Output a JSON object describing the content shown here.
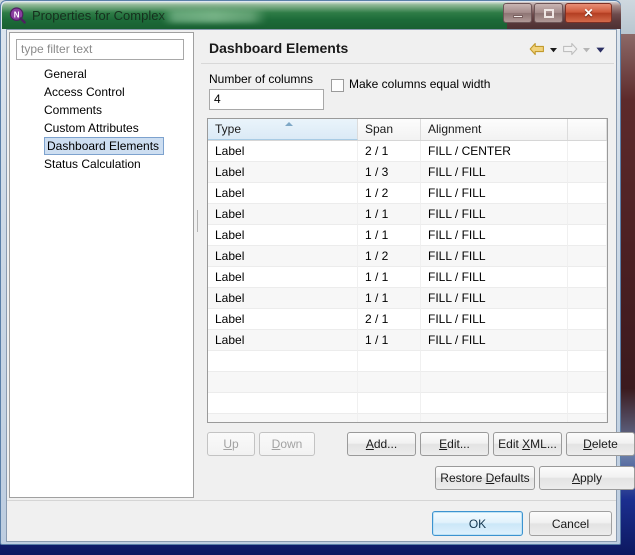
{
  "window": {
    "title": "Properties for Complex",
    "app_icon": "magnifier-n-icon",
    "controls": {
      "minimize": "minimize-icon",
      "maximize": "maximize-icon",
      "close": "✕"
    }
  },
  "sidebar": {
    "filter_placeholder": "type filter text",
    "filter_value": "",
    "items": [
      {
        "label": "General",
        "selected": false
      },
      {
        "label": "Access Control",
        "selected": false
      },
      {
        "label": "Comments",
        "selected": false
      },
      {
        "label": "Custom Attributes",
        "selected": false
      },
      {
        "label": "Dashboard Elements",
        "selected": true
      },
      {
        "label": "Status Calculation",
        "selected": false
      }
    ]
  },
  "main": {
    "title": "Dashboard Elements",
    "nav": {
      "back": "back-arrow-icon",
      "back_menu": "chevron-down-icon",
      "forward": "forward-arrow-icon",
      "forward_menu": "chevron-down-icon",
      "more_menu": "chevron-down-icon"
    },
    "columns_field": {
      "label": "Number of columns",
      "value": "4"
    },
    "equal_width": {
      "label": "Make columns equal width",
      "checked": false
    },
    "table": {
      "headers": [
        "Type",
        "Span",
        "Alignment",
        ""
      ],
      "sorted_column": "Type",
      "sort_direction": "ascending",
      "rows": [
        [
          "Label",
          "2 / 1",
          "FILL / CENTER",
          ""
        ],
        [
          "Label",
          "1 / 3",
          "FILL / FILL",
          ""
        ],
        [
          "Label",
          "1 / 2",
          "FILL / FILL",
          ""
        ],
        [
          "Label",
          "1 / 1",
          "FILL / FILL",
          ""
        ],
        [
          "Label",
          "1 / 1",
          "FILL / FILL",
          ""
        ],
        [
          "Label",
          "1 / 2",
          "FILL / FILL",
          ""
        ],
        [
          "Label",
          "1 / 1",
          "FILL / FILL",
          ""
        ],
        [
          "Label",
          "1 / 1",
          "FILL / FILL",
          ""
        ],
        [
          "Label",
          "2 / 1",
          "FILL / FILL",
          ""
        ],
        [
          "Label",
          "1 / 1",
          "FILL / FILL",
          ""
        ]
      ],
      "empty_row_count": 4
    },
    "buttons": {
      "up": "Up",
      "down": "Down",
      "add": "Add...",
      "edit": "Edit...",
      "edit_xml": "Edit XML...",
      "delete": "Delete",
      "restore_defaults": "Restore Defaults",
      "apply": "Apply"
    },
    "button_states": {
      "up": "disabled",
      "down": "disabled"
    }
  },
  "dialog_buttons": {
    "ok": "OK",
    "cancel": "Cancel",
    "default": "OK"
  },
  "colors": {
    "title_bar_green": "#2e7c46",
    "title_bar_right": "#6e4c4d",
    "close_button_red": "#cf5a3c",
    "selection_blue": "#cddef1",
    "sorted_header_blue": "#dbeaf6",
    "ok_focus_blue": "#3c93d0",
    "nav_back_gold": "#d8a534",
    "nav_forward_gray": "#c3c3c3",
    "desktop_maroon": "#4a1f22",
    "desktop_navy": "#1b2f8f"
  }
}
